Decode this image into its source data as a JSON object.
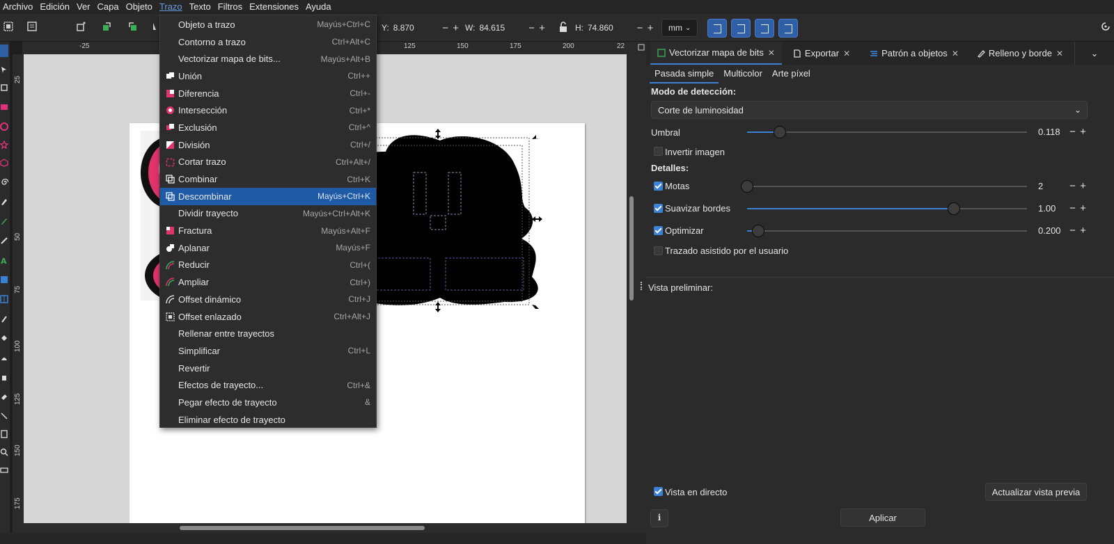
{
  "menubar": {
    "items": [
      "Archivo",
      "Edición",
      "Ver",
      "Capa",
      "Objeto",
      "Trazo",
      "Texto",
      "Filtros",
      "Extensiones",
      "Ayuda"
    ]
  },
  "toolbar": {
    "y": {
      "label": "Y:",
      "value": "8.870"
    },
    "w": {
      "label": "W:",
      "value": "84.615"
    },
    "h": {
      "label": "H:",
      "value": "74.860"
    },
    "unit": "mm",
    "minus": "−",
    "plus": "+"
  },
  "ruler": {
    "top_labels": [
      "-25",
      "125",
      "150",
      "175",
      "200",
      "22"
    ],
    "left_labels": [
      "25",
      "50",
      "75",
      "100",
      "125",
      "150",
      "175"
    ]
  },
  "trazo_menu": {
    "items": [
      {
        "label": "Objeto a trazo",
        "shortcut": "Mayús+Ctrl+C",
        "icon": ""
      },
      {
        "label": "Contorno a trazo",
        "shortcut": "Ctrl+Alt+C",
        "icon": ""
      },
      {
        "label": "Vectorizar mapa de bits...",
        "shortcut": "Mayús+Alt+B",
        "icon": ""
      },
      {
        "label": "Unión",
        "shortcut": "Ctrl++",
        "icon": "union-icon"
      },
      {
        "label": "Diferencia",
        "shortcut": "Ctrl+-",
        "icon": "difference-icon"
      },
      {
        "label": "Intersección",
        "shortcut": "Ctrl+*",
        "icon": "intersection-icon"
      },
      {
        "label": "Exclusión",
        "shortcut": "Ctrl+^",
        "icon": "exclusion-icon"
      },
      {
        "label": "División",
        "shortcut": "Ctrl+/",
        "icon": "division-icon"
      },
      {
        "label": "Cortar trazo",
        "shortcut": "Ctrl+Alt+/",
        "icon": "cut-path-icon"
      },
      {
        "label": "Combinar",
        "shortcut": "Ctrl+K",
        "icon": "combine-icon"
      },
      {
        "label": "Descombinar",
        "shortcut": "Mayús+Ctrl+K",
        "icon": "break-apart-icon"
      },
      {
        "label": "Dividir trayecto",
        "shortcut": "Mayús+Ctrl+Alt+K",
        "icon": ""
      },
      {
        "label": "Fractura",
        "shortcut": "Mayús+Alt+F",
        "icon": "fracture-icon"
      },
      {
        "label": "Aplanar",
        "shortcut": "Mayús+F",
        "icon": "flatten-icon"
      },
      {
        "label": "Reducir",
        "shortcut": "Ctrl+(",
        "icon": "inset-icon"
      },
      {
        "label": "Ampliar",
        "shortcut": "Ctrl+)",
        "icon": "outset-icon"
      },
      {
        "label": "Offset dinámico",
        "shortcut": "Ctrl+J",
        "icon": "dynamic-offset-icon"
      },
      {
        "label": "Offset enlazado",
        "shortcut": "Ctrl+Alt+J",
        "icon": "linked-offset-icon"
      },
      {
        "label": "Rellenar entre trayectos",
        "shortcut": "",
        "icon": ""
      },
      {
        "label": "Simplificar",
        "shortcut": "Ctrl+L",
        "icon": ""
      },
      {
        "label": "Revertir",
        "shortcut": "",
        "icon": ""
      },
      {
        "label": "Efectos de trayecto...",
        "shortcut": "Ctrl+&",
        "icon": ""
      },
      {
        "label": "Pegar efecto de trayecto",
        "shortcut": "&",
        "icon": ""
      },
      {
        "label": "Eliminar efecto de trayecto",
        "shortcut": "",
        "icon": ""
      }
    ],
    "highlighted_index": 10
  },
  "dock": {
    "tabs": [
      {
        "label": "Vectorizar mapa de bits",
        "close": "✕"
      },
      {
        "label": "Exportar",
        "close": "✕"
      },
      {
        "label": "Patrón a objetos",
        "close": "✕"
      },
      {
        "label": "Relleno y borde",
        "close": "✕"
      }
    ],
    "subtabs": [
      "Pasada simple",
      "Multicolor",
      "Arte píxel"
    ],
    "mode_label": "Modo de detección:",
    "mode_value": "Corte de luminosidad",
    "umbral": {
      "label": "Umbral",
      "value": "0.118",
      "level": 0.118
    },
    "invertir": {
      "label": "Invertir imagen",
      "checked": false
    },
    "detalles_label": "Detalles:",
    "motas": {
      "label": "Motas",
      "value": "2",
      "checked": true,
      "level": 0.0
    },
    "suavizar": {
      "label": "Suavizar bordes",
      "value": "1.00",
      "checked": true,
      "level": 0.74
    },
    "optimizar": {
      "label": "Optimizar",
      "value": "0.200",
      "checked": true,
      "level": 0.04
    },
    "trazado_asistido": {
      "label": "Trazado asistido por el usuario",
      "checked": false
    },
    "preview_label": "Vista preliminar:",
    "live_preview": {
      "label": "Vista en directo",
      "checked": true
    },
    "update_preview": "Actualizar vista previa",
    "apply": "Aplicar"
  },
  "colors": {
    "accent": "#3b82d6",
    "menu_highlight": "#1f5aa6",
    "kirby_pink": "#e0346a",
    "kirby_light_pink": "#f2a8bc"
  }
}
